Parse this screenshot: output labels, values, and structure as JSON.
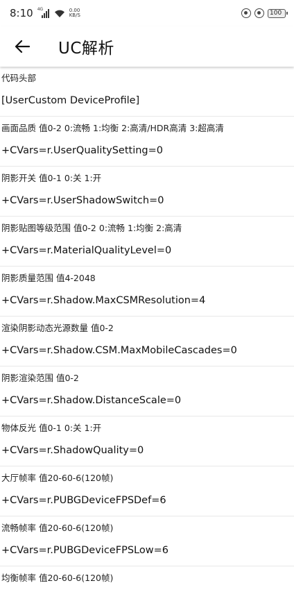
{
  "status_bar": {
    "time": "8:10",
    "signal_tag": "4G",
    "net_speed_value": "0.00",
    "net_speed_unit": "KB/S",
    "battery": "100"
  },
  "header": {
    "title": "UC解析",
    "back_icon": "arrow-left-icon"
  },
  "entries": [
    {
      "label": "代码头部",
      "value": "[UserCustom DeviceProfile]"
    },
    {
      "label": "画面品质 值0-2 0:流畅 1:均衡 2:高清/HDR高清 3:超高清",
      "value": "+CVars=r.UserQualitySetting=0"
    },
    {
      "label": "阴影开关 值0-1 0:关 1:开",
      "value": "+CVars=r.UserShadowSwitch=0"
    },
    {
      "label": "阴影贴图等级范围 值0-2 0:流畅 1:均衡 2:高清",
      "value": "+CVars=r.MaterialQualityLevel=0"
    },
    {
      "label": "阴影质量范围 值4-2048",
      "value": "+CVars=r.Shadow.MaxCSMResolution=4"
    },
    {
      "label": "渲染阴影动态光源数量 值0-2",
      "value": "+CVars=r.Shadow.CSM.MaxMobileCascades=0"
    },
    {
      "label": "阴影渲染范围 值0-2",
      "value": "+CVars=r.Shadow.DistanceScale=0"
    },
    {
      "label": "物体反光 值0-1 0:关 1:开",
      "value": "+CVars=r.ShadowQuality=0"
    },
    {
      "label": "大厅帧率 值20-60-6(120帧)",
      "value": "+CVars=r.PUBGDeviceFPSDef=6"
    },
    {
      "label": "流畅帧率 值20-60-6(120帧)",
      "value": "+CVars=r.PUBGDeviceFPSLow=6"
    },
    {
      "label": "均衡帧率 值20-60-6(120帧)",
      "value": ""
    }
  ]
}
